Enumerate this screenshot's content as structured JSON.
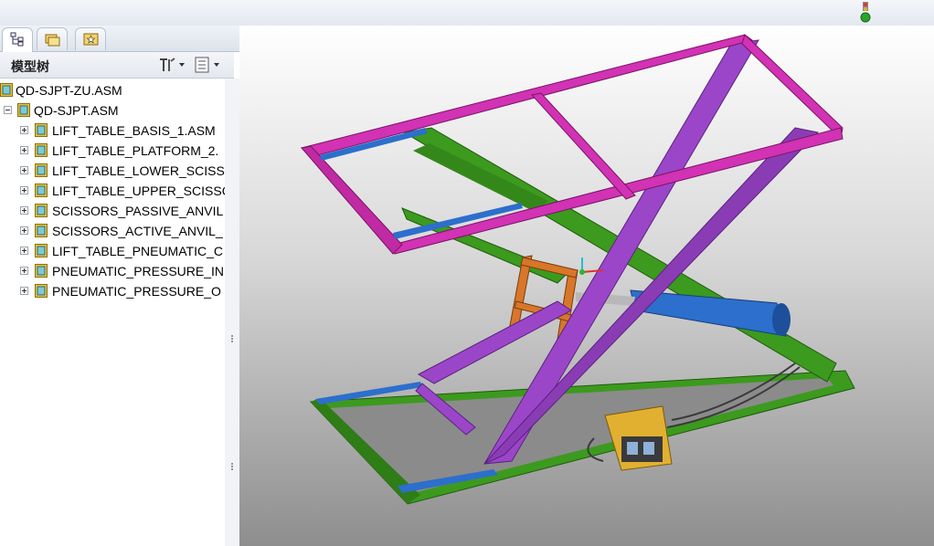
{
  "app": {
    "status_icon": "traffic-light-icon"
  },
  "panel": {
    "tabs": [
      {
        "icon": "model-tree-tab-icon",
        "active": true
      },
      {
        "icon": "folder-browser-tab-icon",
        "active": false
      },
      {
        "icon": "favorites-tab-icon",
        "active": false
      }
    ],
    "title": "模型树",
    "settings_icon": "tree-settings-icon",
    "columns_icon": "tree-columns-icon"
  },
  "tree": {
    "root": "QD-SJPT-ZU.ASM",
    "child": "QD-SJPT.ASM",
    "items": [
      "LIFT_TABLE_BASIS_1.ASM",
      "LIFT_TABLE_PLATFORM_2.",
      "LIFT_TABLE_LOWER_SCISS",
      "LIFT_TABLE_UPPER_SCISSC",
      "SCISSORS_PASSIVE_ANVIL",
      "SCISSORS_ACTIVE_ANVIL_",
      "LIFT_TABLE_PNEUMATIC_C",
      "PNEUMATIC_PRESSURE_IN",
      "PNEUMATIC_PRESSURE_O"
    ]
  },
  "viewport": {
    "model": "scissor-lift-table-3d-model",
    "colors": {
      "platform": "#d232b4",
      "upper_scissor": "#9b46c8",
      "lower_scissor": "#3c9a1e",
      "cylinder": "#2c6fcc",
      "base": "#3c9a1e",
      "valve_box": "#e2b030",
      "bracket": "#d8762a"
    }
  }
}
